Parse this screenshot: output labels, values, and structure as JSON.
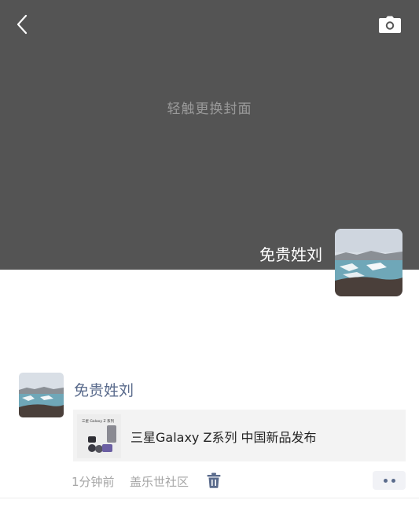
{
  "cover": {
    "hint": "轻触更换封面",
    "back_icon": "chevron-left-icon",
    "camera_icon": "camera-icon",
    "background_color": "#545454"
  },
  "profile": {
    "name": "免贵姓刘"
  },
  "post": {
    "author": "免贵姓刘",
    "link": {
      "title": "三星Galaxy Z系列 中国新品发布",
      "thumb_caption": "三星 Galaxy Z 系列"
    },
    "time": "1分钟前",
    "location": "盖乐世社区",
    "delete_icon": "trash-icon",
    "more_icon": "more-dots-icon",
    "author_color": "#5a6b8c"
  }
}
